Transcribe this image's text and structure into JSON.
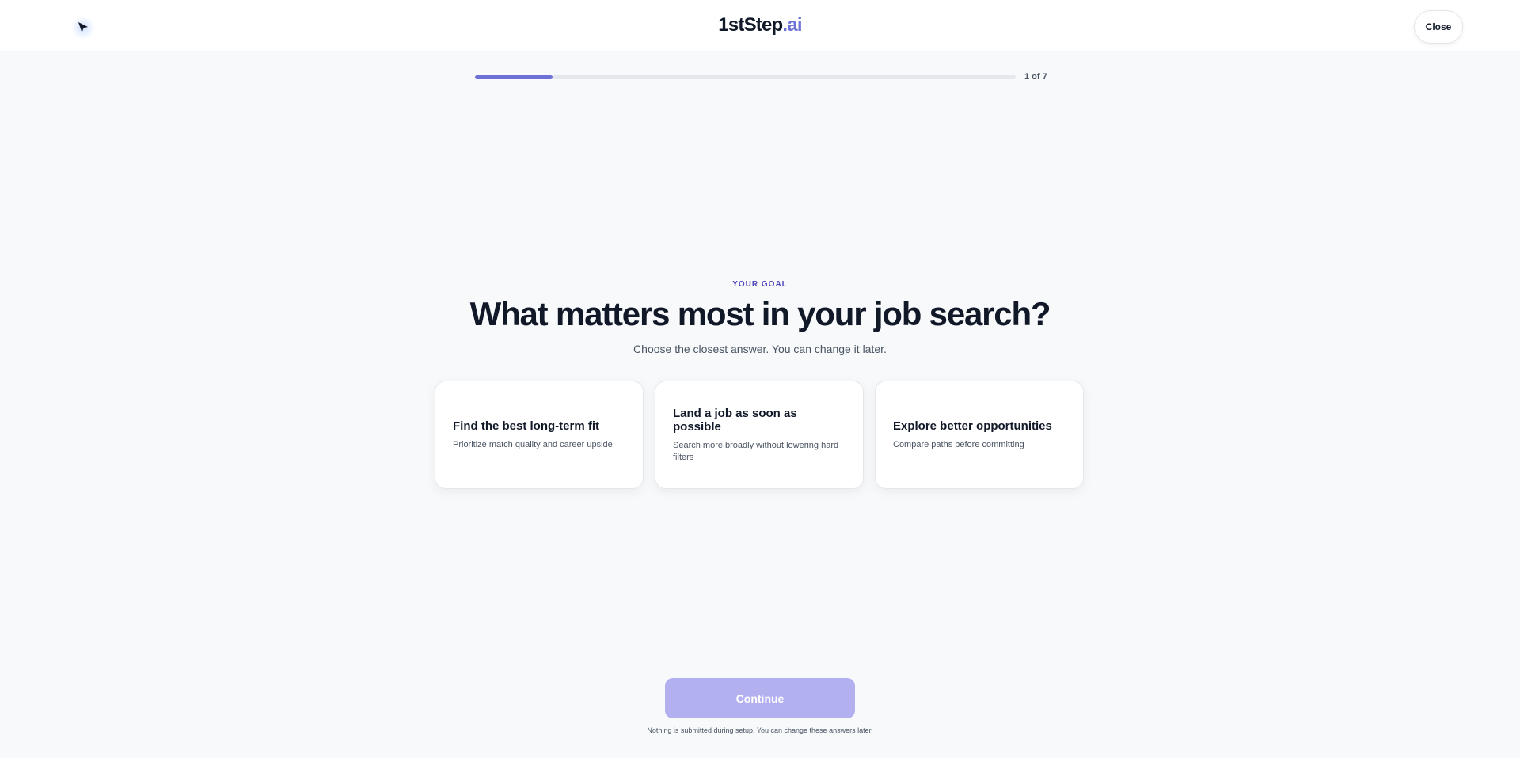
{
  "header": {
    "logo_main": "1stStep",
    "logo_accent": ".ai",
    "close_label": "Close",
    "pointer_icon": "cursor-arrow-icon"
  },
  "progress": {
    "label": "1 of 7",
    "fraction": 0.143,
    "color": "#6c72d6"
  },
  "question": {
    "eyebrow": "YOUR GOAL",
    "title": "What matters most in your job search?",
    "subtitle": "Choose the closest answer. You can change it later."
  },
  "options": [
    {
      "title": "Find the best long-term fit",
      "description": "Prioritize match quality and career upside"
    },
    {
      "title": "Land a job as soon as possible",
      "description": "Search more broadly without lowering hard filters"
    },
    {
      "title": "Explore better opportunities",
      "description": "Compare paths before committing"
    }
  ],
  "footer": {
    "continue_label": "Continue",
    "note": "Nothing is submitted during setup. You can change these answers later."
  },
  "colors": {
    "accent": "#6c72d6",
    "eyebrow": "#4f46b8",
    "continue_disabled": "#b3b0f0",
    "background": "#f7f9fb"
  }
}
